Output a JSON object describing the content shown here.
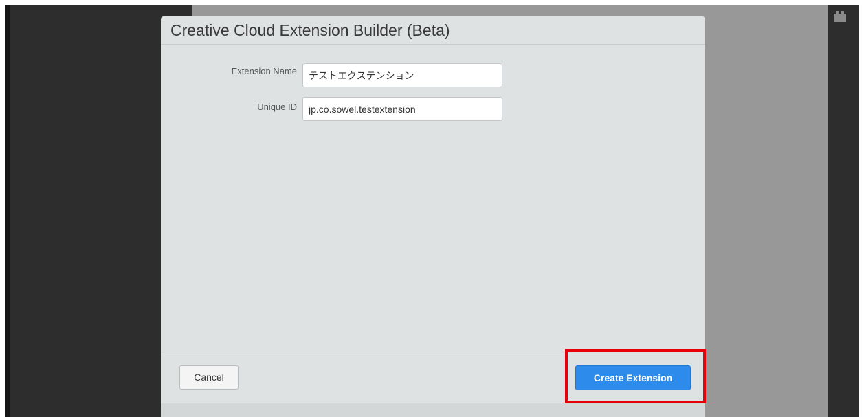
{
  "dialog": {
    "title": "Creative Cloud Extension Builder (Beta)"
  },
  "form": {
    "extension_name_label": "Extension Name",
    "extension_name_value": "テストエクステンション",
    "unique_id_label": "Unique ID",
    "unique_id_value": "jp.co.sowel.testextension"
  },
  "footer": {
    "cancel_label": "Cancel",
    "create_label": "Create Extension"
  },
  "icons": {
    "right_panel_icon": "plugin-icon"
  },
  "colors": {
    "primary_button": "#2d8ceb",
    "highlight_annotation": "#e8000b",
    "dialog_background": "#dfe2e3",
    "app_background": "#2d2d2d",
    "center_background": "#989898"
  }
}
